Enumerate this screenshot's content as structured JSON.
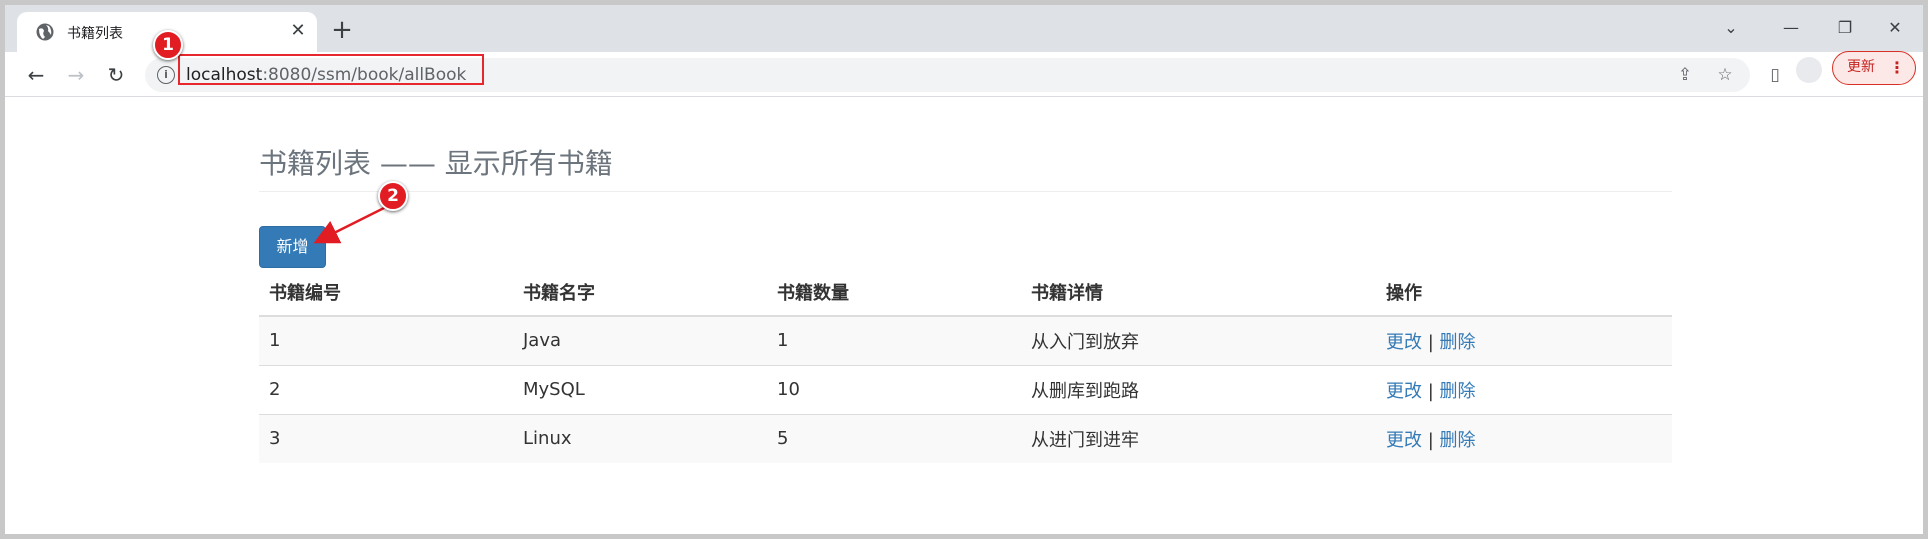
{
  "tab": {
    "title": "书籍列表",
    "close": "✕",
    "newtab": "+"
  },
  "window_controls": {
    "dropdown": "⌄",
    "minimize": "—",
    "restore": "❐",
    "close": "✕"
  },
  "toolbar": {
    "back": "←",
    "forward": "→",
    "reload": "↻",
    "url_host": "localhost",
    "url_rest": ":8080/ssm/book/allBook",
    "info": "i",
    "share": "⇪",
    "star": "☆",
    "sidepanel": "▯",
    "update_label": "更新",
    "menu": "⋮"
  },
  "page": {
    "heading": "书籍列表 —— 显示所有书籍",
    "add_button": "新增",
    "columns": [
      "书籍编号",
      "书籍名字",
      "书籍数量",
      "书籍详情",
      "操作"
    ],
    "rows": [
      {
        "id": "1",
        "name": "Java",
        "count": "1",
        "detail": "从入门到放弃"
      },
      {
        "id": "2",
        "name": "MySQL",
        "count": "10",
        "detail": "从删库到跑路"
      },
      {
        "id": "3",
        "name": "Linux",
        "count": "5",
        "detail": "从进门到进牢"
      }
    ],
    "edit_label": "更改",
    "separator": "|",
    "delete_label": "删除"
  },
  "annotations": {
    "marker1": "1",
    "marker2": "2"
  },
  "colors": {
    "accent": "#337ab7",
    "annotation": "#e11c22"
  }
}
